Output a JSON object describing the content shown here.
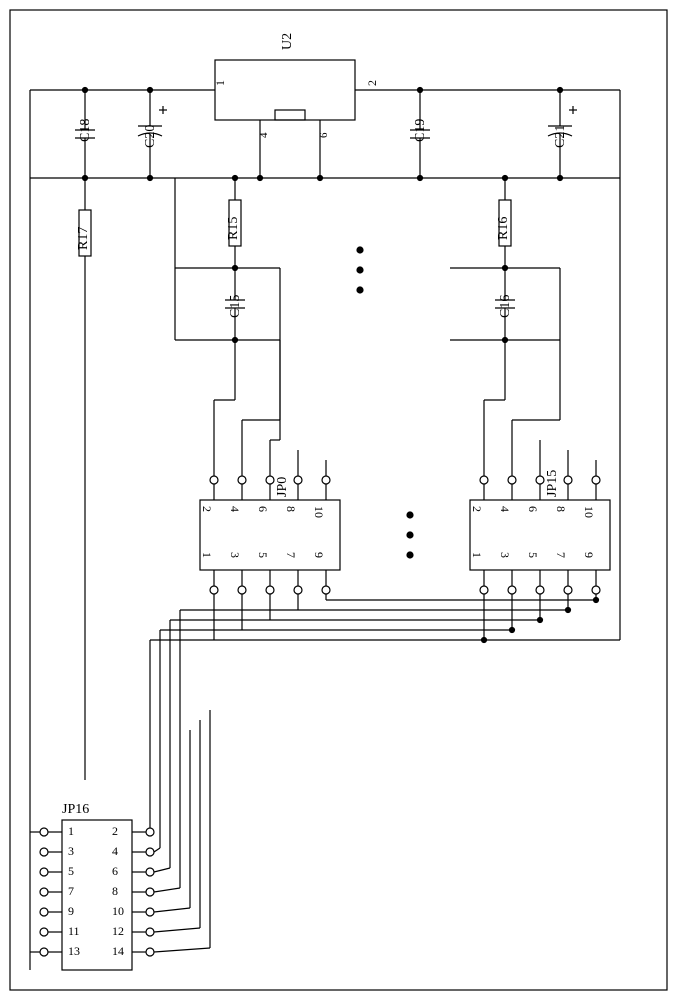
{
  "ic": {
    "name": "U2",
    "pins": {
      "left": "1",
      "right": "2",
      "bottom_a": "4",
      "bottom_b": "6"
    }
  },
  "caps": {
    "c18": "C18",
    "c19": "C19",
    "c20": "C20",
    "c21": "C21",
    "c15": "C15",
    "c16": "C16"
  },
  "res": {
    "r15": "R15",
    "r16": "R16",
    "r17": "R17"
  },
  "connectors": {
    "jp16": {
      "name": "JP16",
      "left": [
        "1",
        "3",
        "5",
        "7",
        "9",
        "11",
        "13"
      ],
      "right": [
        "2",
        "4",
        "6",
        "8",
        "10",
        "12",
        "14"
      ]
    },
    "jp0": {
      "name": "JP0",
      "top": [
        "2",
        "4",
        "6",
        "8",
        "10"
      ],
      "bottom": [
        "1",
        "3",
        "5",
        "7",
        "9"
      ]
    },
    "jp15": {
      "name": "JP15",
      "top": [
        "2",
        "4",
        "6",
        "8",
        "10"
      ],
      "bottom": [
        "1",
        "3",
        "5",
        "7",
        "9"
      ]
    }
  },
  "chart_data": null
}
